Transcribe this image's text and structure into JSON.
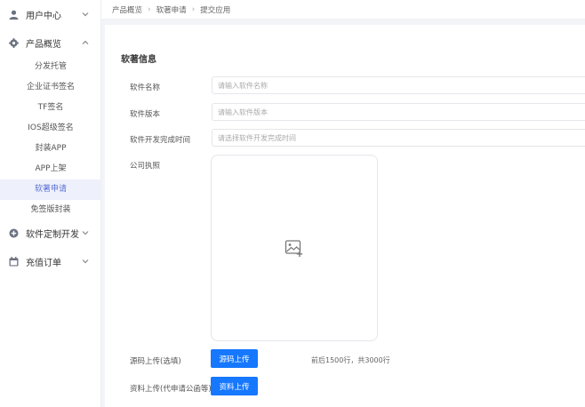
{
  "sidebar": {
    "groups": [
      {
        "label": "用户中心",
        "icon": "user-icon",
        "expanded": false
      },
      {
        "label": "产品概览",
        "icon": "gear-icon",
        "expanded": true,
        "items": [
          {
            "label": "分发托管",
            "active": false
          },
          {
            "label": "企业证书签名",
            "active": false
          },
          {
            "label": "TF签名",
            "active": false
          },
          {
            "label": "IOS超级签名",
            "active": false
          },
          {
            "label": "封装APP",
            "active": false
          },
          {
            "label": "APP上架",
            "active": false
          },
          {
            "label": "软著申请",
            "active": true
          },
          {
            "label": "免签版封装",
            "active": false
          }
        ]
      },
      {
        "label": "软件定制开发",
        "icon": "plus-circle-icon",
        "expanded": false
      },
      {
        "label": "充值订单",
        "icon": "calendar-icon",
        "expanded": false
      }
    ]
  },
  "breadcrumb": [
    "产品概览",
    "软著申请",
    "提交应用"
  ],
  "form": {
    "section_title": "软著信息",
    "software_name_label": "软件名称",
    "software_name_placeholder": "请输入软件名称",
    "software_version_label": "软件版本",
    "software_version_placeholder": "请输入软件版本",
    "dev_finish_time_label": "软件开发完成时间",
    "dev_finish_time_placeholder": "请选择软件开发完成时间",
    "business_license_label": "公司执照",
    "source_upload_label": "源码上传(选填)",
    "source_upload_button": "源码上传",
    "source_upload_hint": "前后1500行，共3000行",
    "material_upload_label": "资料上传(代申请公函等)",
    "material_upload_button": "资料上传"
  },
  "colors": {
    "accent": "#1677ff",
    "active_menu_bg": "#eef1fb",
    "active_menu_text": "#5b6fd6"
  }
}
